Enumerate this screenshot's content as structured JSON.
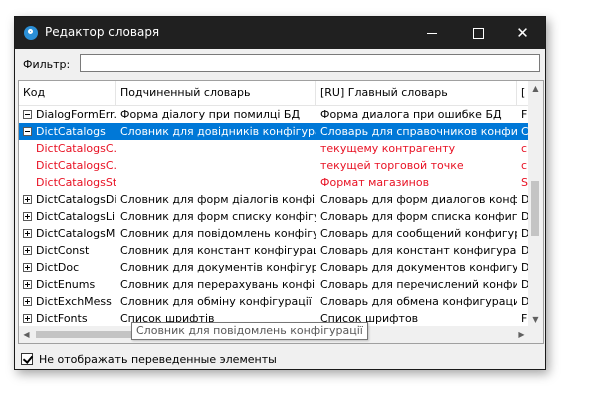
{
  "window": {
    "title": "Редактор словаря",
    "controls": {
      "minimize": "—",
      "maximize": "☐",
      "close": "✕"
    }
  },
  "filter": {
    "label": "Фильтр:",
    "value": ""
  },
  "columns": [
    "Код",
    "Подчиненный словарь",
    "[RU] Главный словарь",
    "["
  ],
  "rows": [
    {
      "code": "DialogFormErr...",
      "sub": "Форма діалогу при помилці БД",
      "main": "Форма диалога при ошибке БД",
      "extra": "F",
      "expander": "minus",
      "state": "normal"
    },
    {
      "code": "DictCatalogs",
      "sub": "Словник для довідників конфігурації",
      "main": "Словарь для справочников конфиг...",
      "extra": "C",
      "expander": "minus",
      "state": "selected"
    },
    {
      "code": "DictCatalogsC...",
      "sub": "",
      "main": "текущему контрагенту",
      "extra": "c",
      "expander": "none",
      "state": "red"
    },
    {
      "code": "DictCatalogsC...",
      "sub": "",
      "main": "текущей торговой точке",
      "extra": "c",
      "expander": "none",
      "state": "red"
    },
    {
      "code": "DictCatalogsSt...",
      "sub": "",
      "main": "Формат магазинов",
      "extra": "S",
      "expander": "none",
      "state": "red"
    },
    {
      "code": "DictCatalogsDi...",
      "sub": "Словник для форм діалогів конфіг...",
      "main": "Словарь для форм диалогов конф...",
      "extra": "D",
      "expander": "plus",
      "state": "normal"
    },
    {
      "code": "DictCatalogsLi...",
      "sub": "Словник для форм списку конфігу...",
      "main": "Словарь для форм списка конфиг...",
      "extra": "D",
      "expander": "plus",
      "state": "normal"
    },
    {
      "code": "DictCatalogsM...",
      "sub": "Словник для повідомлень конфігу...",
      "main": "Словарь для сообщений конфигур...",
      "extra": "D",
      "expander": "plus",
      "state": "normal"
    },
    {
      "code": "DictConst",
      "sub": "Словник для констант конфігурації",
      "main": "Словарь для констант конфигурации",
      "extra": "D",
      "expander": "plus",
      "state": "normal"
    },
    {
      "code": "DictDoc",
      "sub": "Словник для документів конфігур...",
      "main": "Словарь для документов конфигур...",
      "extra": "D",
      "expander": "plus",
      "state": "normal"
    },
    {
      "code": "DictEnums",
      "sub": "Словник для перерахувань конфігу...",
      "main": "Словарь для перечислений конфиг...",
      "extra": "D",
      "expander": "plus",
      "state": "normal"
    },
    {
      "code": "DictExchMess",
      "sub": "Словник для обміну конфігурації",
      "main": "Словарь для обмена конфигурации",
      "extra": "D",
      "expander": "plus",
      "state": "normal"
    },
    {
      "code": "DictFonts",
      "sub": "Список шрифтів",
      "main": "Список шрифтов",
      "extra": "F",
      "expander": "plus",
      "state": "normal"
    }
  ],
  "tooltip": "Словник для повідомлень конфігурації",
  "option": {
    "label": "Не отображать переведенные элементы",
    "checked": true
  },
  "colors": {
    "selection": "#0078d7",
    "untranslated": "#e81123",
    "titlebar": "#202020"
  }
}
